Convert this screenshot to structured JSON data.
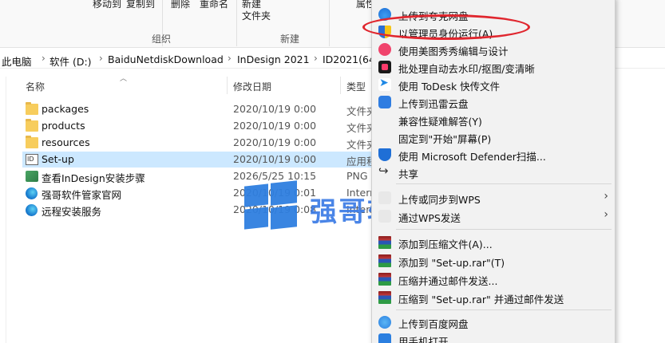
{
  "ribbon": {
    "move_to": "移动到",
    "copy_to": "复制到",
    "delete": "删除",
    "rename": "重命名",
    "new_folder_line1": "新建",
    "new_folder_line2": "文件夹",
    "properties": "属性",
    "group_organize": "组织",
    "group_new": "新建"
  },
  "breadcrumb": [
    "此电脑",
    "软件 (D:)",
    "BaiduNetdiskDownload",
    "InDesign 2021",
    "ID2021(64"
  ],
  "columns": {
    "name": "名称",
    "date": "修改日期",
    "type": "类型"
  },
  "files": [
    {
      "name": "packages",
      "date": "2020/10/19 0:00",
      "type": "文件夹",
      "icon": "folder-icon"
    },
    {
      "name": "products",
      "date": "2020/10/19 0:00",
      "type": "文件夹",
      "icon": "folder-icon"
    },
    {
      "name": "resources",
      "date": "2020/10/19 0:00",
      "type": "文件夹",
      "icon": "folder-icon"
    },
    {
      "name": "Set-up",
      "date": "2020/10/19 0:00",
      "type": "应用程序",
      "icon": "exe-icon",
      "selected": true
    },
    {
      "name": "查看InDesign安装步骤",
      "date": "2026/5/25 10:15",
      "type": "PNG",
      "icon": "png-icon"
    },
    {
      "name": "强哥软件管家官网",
      "date": "2020/10/19 0:01",
      "type": "Internet",
      "icon": "edge-icon"
    },
    {
      "name": "远程安装服务",
      "date": "2020/10/19 0:08",
      "type": "Internet",
      "icon": "edge-icon"
    }
  ],
  "watermark": {
    "text": "强哥软件管家"
  },
  "context_menu": {
    "items": [
      {
        "label": "上传到夸克网盘",
        "icon": "quark-cloud-icon"
      },
      {
        "label": "以管理员身份运行(A)",
        "icon": "uac-shield-icon",
        "highlighted": true
      },
      {
        "label": "使用美图秀秀编辑与设计",
        "icon": "meitu-icon"
      },
      {
        "label": "批处理自动去水印/抠图/变清晰",
        "icon": "batch-process-icon"
      },
      {
        "label": "使用 ToDesk 快传文件",
        "icon": "todesk-icon"
      },
      {
        "label": "上传到迅雷云盘",
        "icon": "xunlei-icon"
      },
      {
        "label": "兼容性疑难解答(Y)",
        "icon": ""
      },
      {
        "label": "固定到\"开始\"屏幕(P)",
        "icon": ""
      },
      {
        "label": "使用 Microsoft Defender扫描...",
        "icon": "defender-icon"
      },
      {
        "label": "共享",
        "icon": "share-icon"
      },
      {
        "label": "上传或同步到WPS",
        "icon": "wps-icon",
        "submenu": true
      },
      {
        "label": "通过WPS发送",
        "icon": "wps-icon",
        "submenu": true
      },
      {
        "label": "添加到压缩文件(A)...",
        "icon": "winrar-icon"
      },
      {
        "label": "添加到 \"Set-up.rar\"(T)",
        "icon": "winrar-icon"
      },
      {
        "label": "压缩并通过邮件发送...",
        "icon": "winrar-icon"
      },
      {
        "label": "压缩到 \"Set-up.rar\" 并通过邮件发送",
        "icon": "winrar-icon"
      },
      {
        "label": "上传到百度网盘",
        "icon": "baidu-cloud-icon"
      },
      {
        "label": "用手机打开",
        "icon": "phone-icon"
      }
    ]
  },
  "colors": {
    "selection": "#cce8ff",
    "annotation": "#e0262e",
    "watermark": "#3b7be6",
    "menu_bg": "#f2f2f2"
  }
}
